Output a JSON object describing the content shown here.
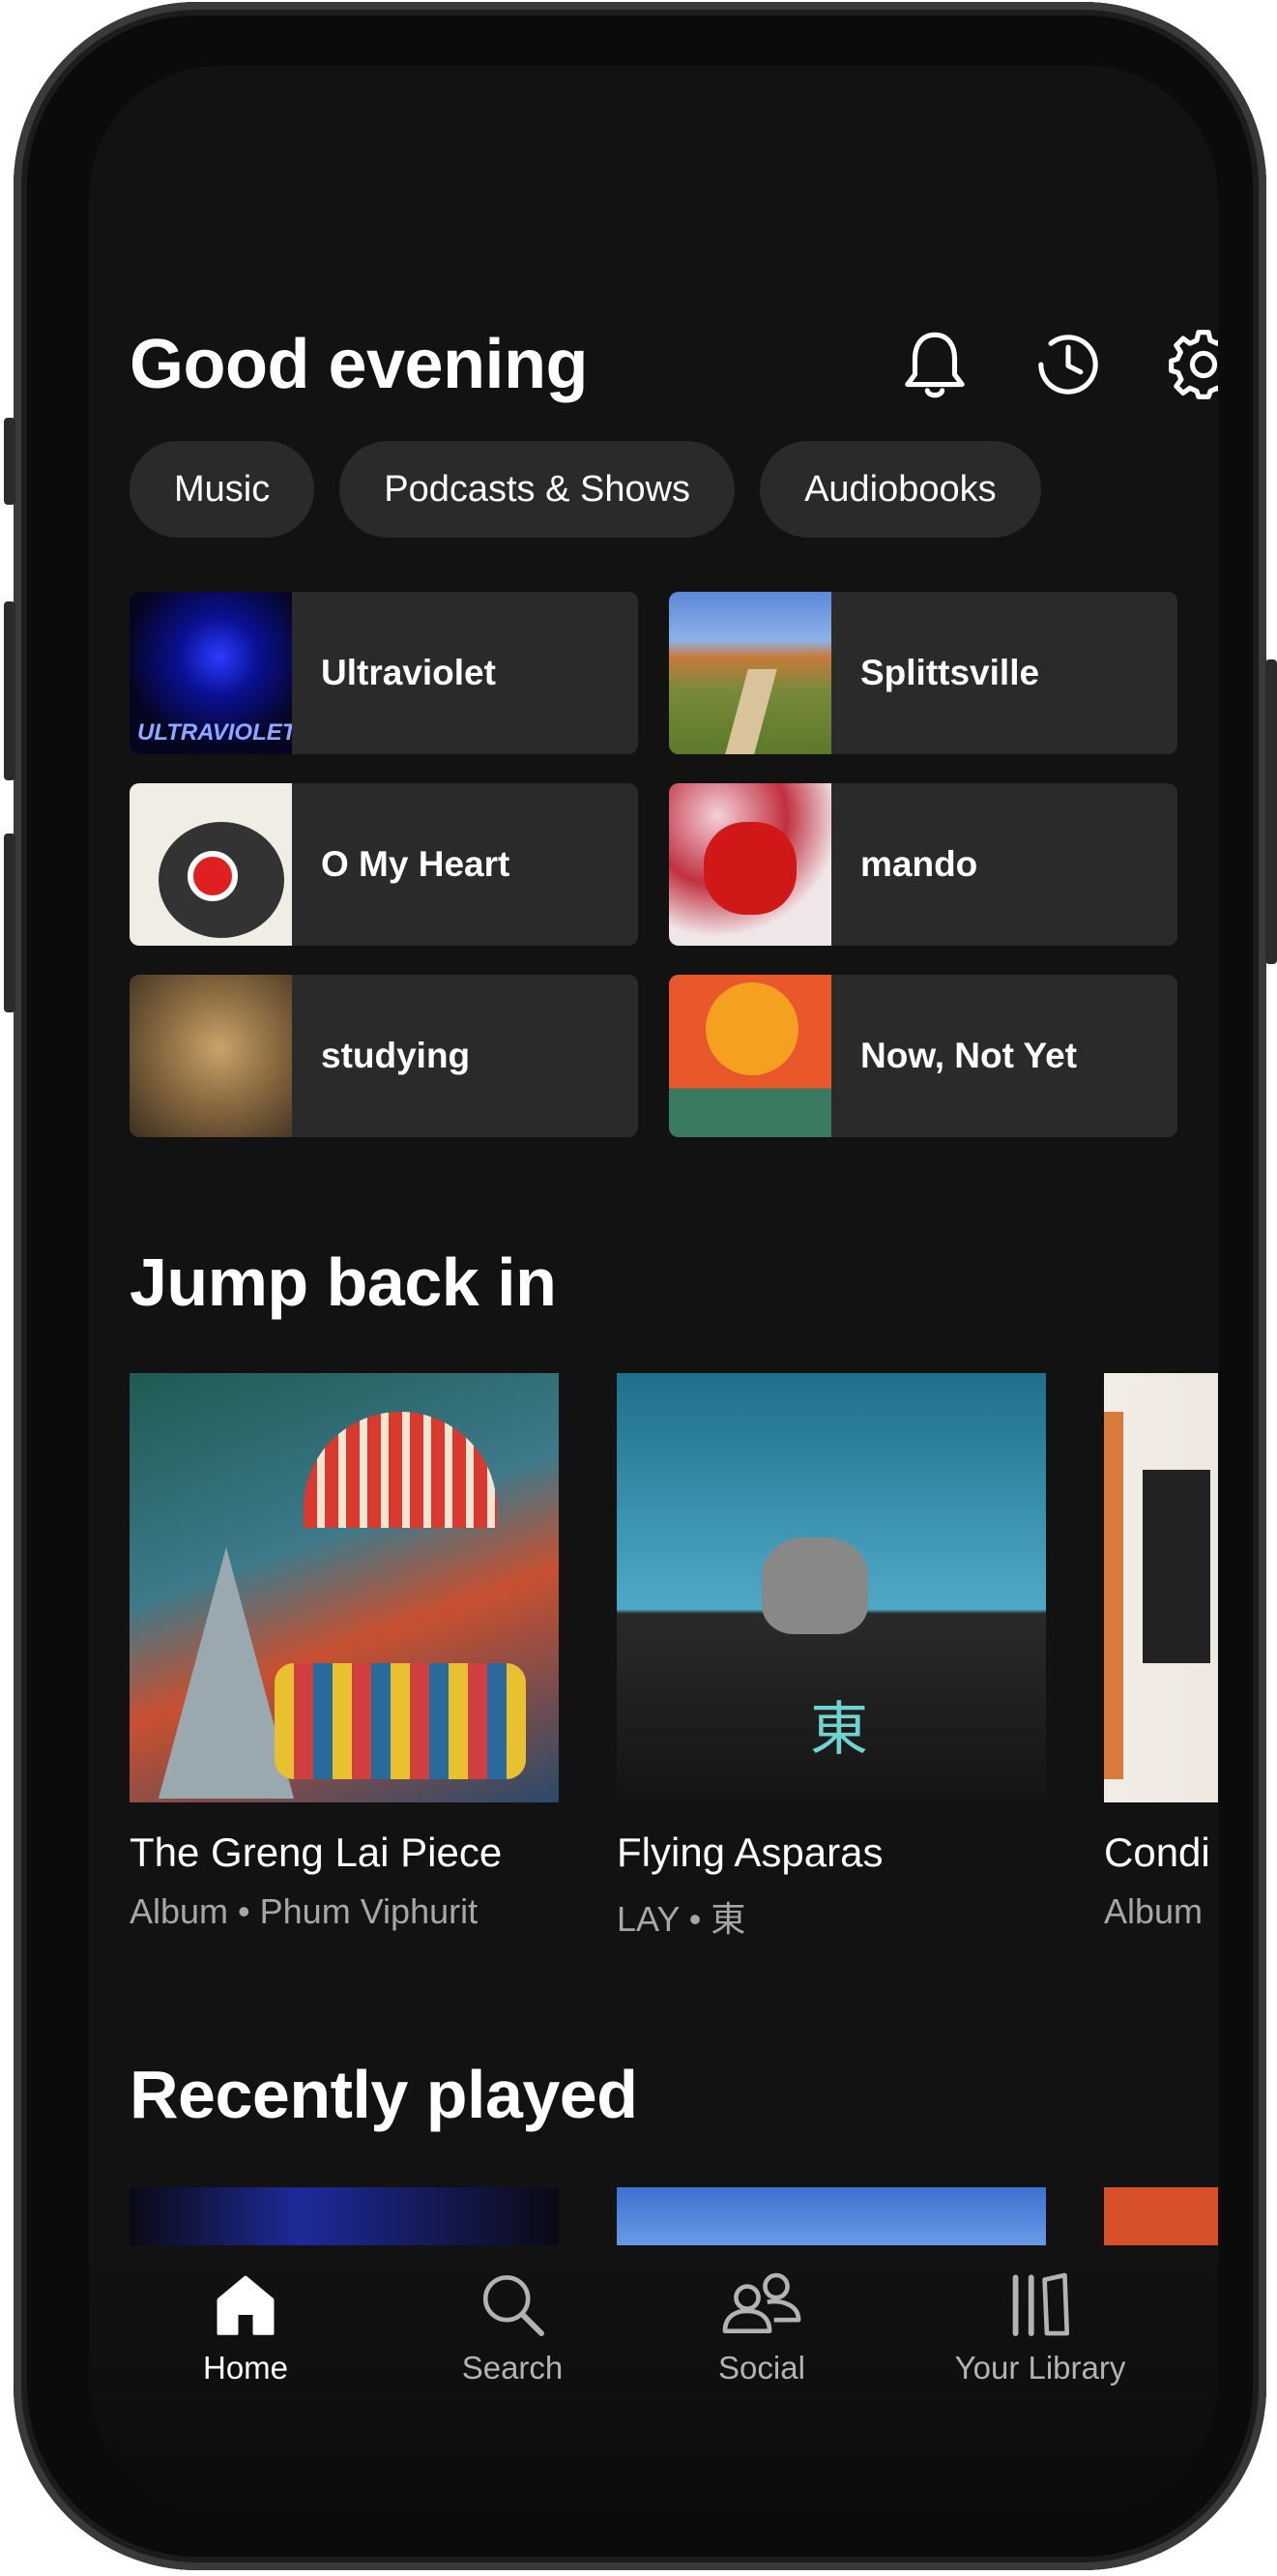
{
  "header": {
    "greeting": "Good evening"
  },
  "filters": [
    "Music",
    "Podcasts & Shows",
    "Audiobooks"
  ],
  "shortcuts": [
    {
      "label": "Ultraviolet"
    },
    {
      "label": "Splittsville"
    },
    {
      "label": "O My Heart"
    },
    {
      "label": "mando"
    },
    {
      "label": "studying"
    },
    {
      "label": "Now, Not Yet"
    }
  ],
  "jump_back_in": {
    "title": "Jump back in",
    "items": [
      {
        "title": "The Greng Lai Piece",
        "subtitle": "Album • Phum Viphurit"
      },
      {
        "title": "Flying Asparas",
        "subtitle": "LAY • 東"
      },
      {
        "title": "Condi",
        "subtitle": "Album"
      }
    ]
  },
  "recently_played": {
    "title": "Recently played"
  },
  "nav": [
    {
      "label": "Home",
      "icon": "home-icon",
      "active": true
    },
    {
      "label": "Search",
      "icon": "search-icon",
      "active": false
    },
    {
      "label": "Social",
      "icon": "social-icon",
      "active": false
    },
    {
      "label": "Your Library",
      "icon": "library-icon",
      "active": false
    }
  ],
  "colors": {
    "background": "#121212",
    "tile": "#2a2a2a",
    "text": "#ffffff",
    "muted": "#a7a7a7"
  }
}
